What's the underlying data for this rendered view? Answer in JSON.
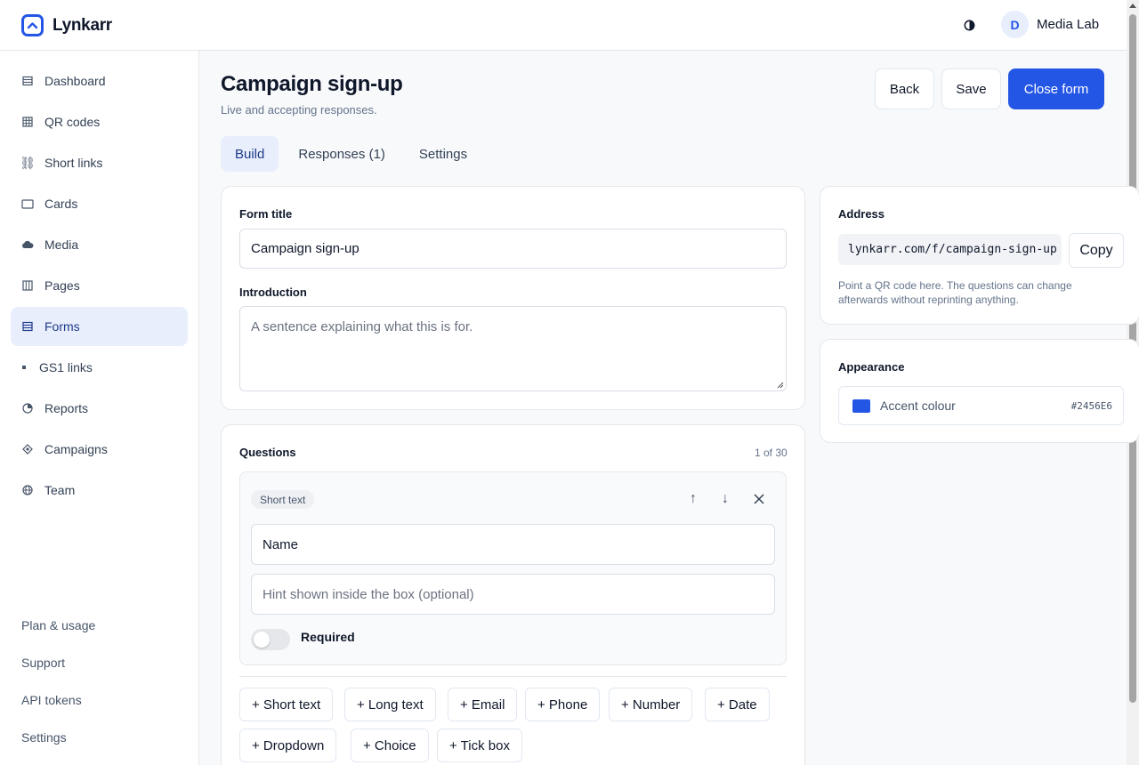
{
  "app": {
    "brand": "Lynkarr",
    "accent_color": "#2456E6"
  },
  "header": {
    "theme_icon": "contrast-icon",
    "user": {
      "initial": "D",
      "name": "Media Lab"
    }
  },
  "sidebar": {
    "items": [
      {
        "label": "Dashboard",
        "icon": "list-icon"
      },
      {
        "label": "QR codes",
        "icon": "grid-icon"
      },
      {
        "label": "Short links",
        "icon": "link-icon"
      },
      {
        "label": "Cards",
        "icon": "card-icon"
      },
      {
        "label": "Media",
        "icon": "cloud-icon"
      },
      {
        "label": "Pages",
        "icon": "columns-icon"
      },
      {
        "label": "Forms",
        "icon": "form-icon",
        "active": true
      },
      {
        "label": "GS1 links",
        "icon": "dot-icon"
      },
      {
        "label": "Reports",
        "icon": "pie-icon"
      },
      {
        "label": "Campaigns",
        "icon": "diamond-icon"
      },
      {
        "label": "Team",
        "icon": "globe-icon"
      }
    ],
    "footer": [
      "Plan & usage",
      "Support",
      "API tokens",
      "Settings"
    ]
  },
  "page": {
    "title": "Campaign sign-up",
    "subtitle": "Live and accepting responses.",
    "actions": {
      "back": "Back",
      "save": "Save",
      "close": "Close form"
    },
    "tabs": [
      {
        "label": "Build",
        "active": true
      },
      {
        "label": "Responses (1)"
      },
      {
        "label": "Settings"
      }
    ]
  },
  "details": {
    "form_title_label": "Form title",
    "form_title_value": "Campaign sign-up",
    "intro_label": "Introduction",
    "intro_placeholder": "A sentence explaining what this is for."
  },
  "questions": {
    "heading": "Questions",
    "count": "1 of 30",
    "items": [
      {
        "type": "Short text",
        "label_value": "Name",
        "hint_placeholder": "Hint shown inside the box (optional)",
        "required_label": "Required",
        "required": false
      }
    ],
    "add_buttons": [
      "+ Short text",
      "+ Long text",
      "+ Email",
      "+ Phone",
      "+ Number",
      "+ Date",
      "+ Dropdown",
      "+ Choice",
      "+ Tick box"
    ]
  },
  "address": {
    "heading": "Address",
    "url": "lynkarr.com/f/campaign-sign-up",
    "copy_label": "Copy",
    "help": "Point a QR code here. The questions can change afterwards without reprinting anything."
  },
  "appearance": {
    "heading": "Appearance",
    "accent_label": "Accent colour",
    "accent_hex": "#2456E6"
  }
}
